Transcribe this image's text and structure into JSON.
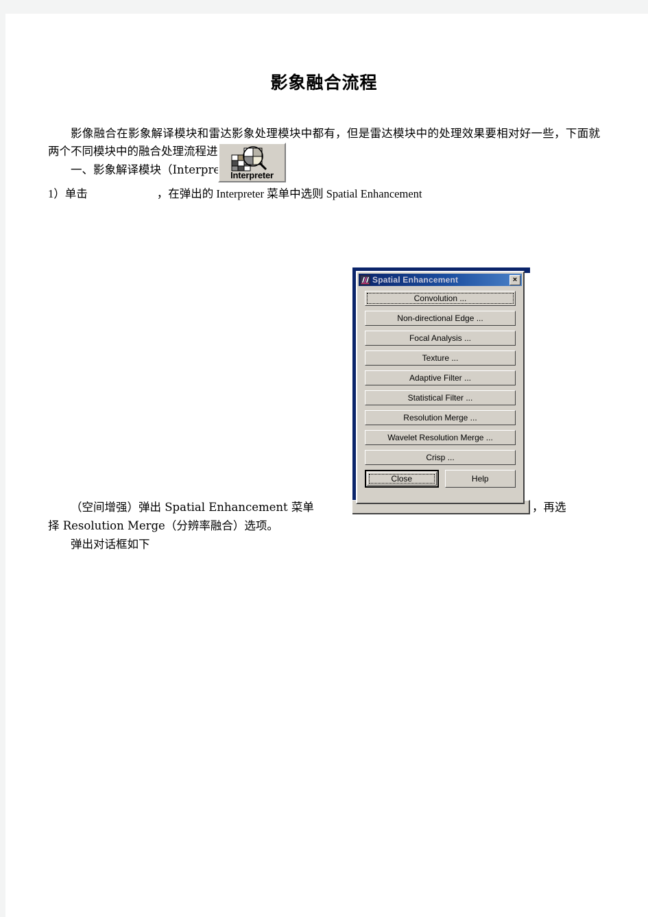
{
  "document": {
    "title": "影象融合流程",
    "paragraph_1": "影像融合在影象解译模块和雷达影象处理模块中都有，但是雷达模块中的处理效果要相对好一些，下面就两个不同模块中的融合处理流程进行分别介绍。",
    "paragraph_2": "一、影象解译模块（Interpreter）",
    "step_1_prefix": "1）单击",
    "step_1_suffix": "，在弹出的 Interpreter 菜单中选则 Spatial Enhancement",
    "wrap_line_1_a": "（空间增强）弹出 Spatial Enhancement 菜单",
    "wrap_line_1_b": "，再选",
    "wrap_line_2": "择 Resolution Merge（分辨率融合）选项。",
    "wrap_line_3": "弹出对话框如下"
  },
  "interpreter_button": {
    "label": "Interpreter",
    "icon": "grid-magnifier-icon"
  },
  "dialog": {
    "title": "Spatial Enhancement",
    "title_icon": "erdas-app-icon",
    "close_icon": "×",
    "buttons": [
      {
        "label": "Convolution ...",
        "name": "convolution",
        "focused": true
      },
      {
        "label": "Non-directional Edge ...",
        "name": "non-directional-edge",
        "focused": false
      },
      {
        "label": "Focal Analysis ...",
        "name": "focal-analysis",
        "focused": false
      },
      {
        "label": "Texture ...",
        "name": "texture",
        "focused": false
      },
      {
        "label": "Adaptive Filter ...",
        "name": "adaptive-filter",
        "focused": false
      },
      {
        "label": "Statistical Filter ...",
        "name": "statistical-filter",
        "focused": false
      },
      {
        "label": "Resolution Merge ...",
        "name": "resolution-merge",
        "focused": false
      },
      {
        "label": "Wavelet Resolution Merge ...",
        "name": "wavelet-resolution-merge",
        "focused": false
      },
      {
        "label": "Crisp ...",
        "name": "crisp",
        "focused": false
      }
    ],
    "close_label": "Close",
    "help_label": "Help"
  },
  "colors": {
    "title_bar_start": "#0a246a",
    "title_bar_end": "#4b82c8",
    "dialog_face": "#d4d0c8",
    "page_background": "#f3f4f4",
    "sheet": "#ffffff"
  }
}
